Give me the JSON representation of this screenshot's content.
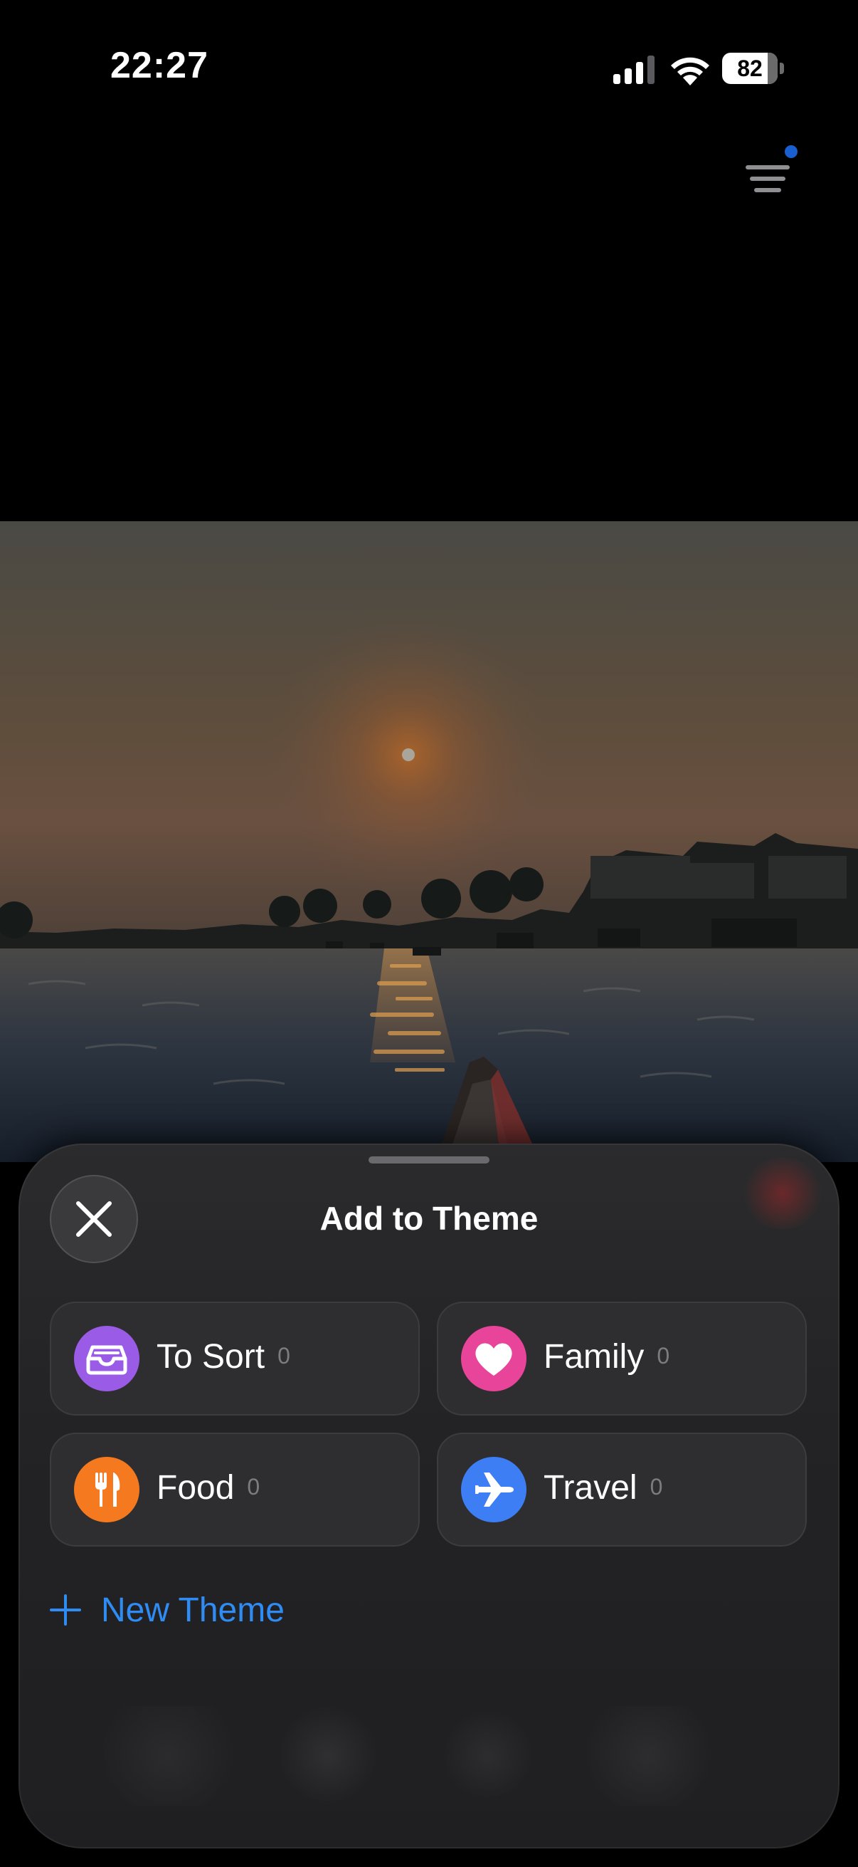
{
  "status_bar": {
    "time": "22:27",
    "battery_level": "82",
    "battery_fraction": 0.82
  },
  "toolbar": {
    "menu_icon": "filter-lines-icon",
    "notification_dot_color": "#1a5fd0"
  },
  "sheet": {
    "title": "Add to Theme",
    "close_icon": "close-icon",
    "themes": [
      {
        "label": "To Sort",
        "count": "0",
        "icon": "tray-icon",
        "color": "#9a5ce6"
      },
      {
        "label": "Family",
        "count": "0",
        "icon": "heart-icon",
        "color": "#e8449a"
      },
      {
        "label": "Food",
        "count": "0",
        "icon": "fork-knife-icon",
        "color": "#f57a1f"
      },
      {
        "label": "Travel",
        "count": "0",
        "icon": "airplane-icon",
        "color": "#3e7ef5"
      }
    ],
    "new_theme_label": "New Theme",
    "accent_color": "#2f8cf4"
  }
}
